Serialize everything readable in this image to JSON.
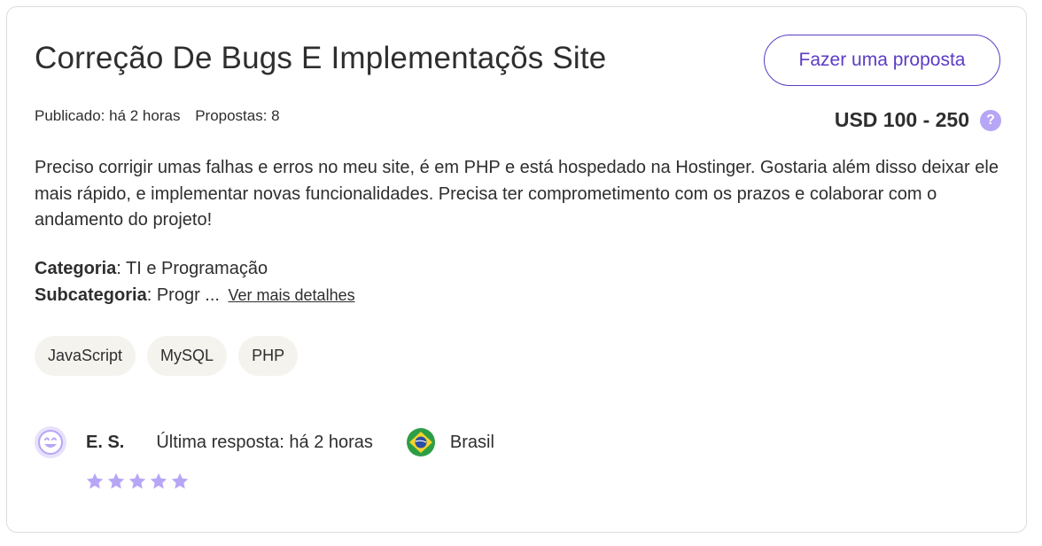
{
  "project": {
    "title": "Correção De Bugs E Implementaçõs Site",
    "proposal_button": "Fazer uma proposta",
    "published": "Publicado: há 2 horas",
    "proposals": "Propostas: 8",
    "budget": "USD 100 - 250",
    "budget_help_icon": "?",
    "description": "Preciso corrigir umas falhas e erros no meu site, é em PHP e está hospedado na Hostinger. Gostaria além disso deixar ele mais rápido, e implementar novas funcionalidades. Precisa ter comprometimento com os prazos e colaborar com o andamento do projeto!",
    "category_label": "Categoria",
    "category_value": ": TI e Programação",
    "subcategory_label": "Subcategoria",
    "subcategory_value": ": Progr ...",
    "more_details_link": "Ver mais detalhes",
    "tags": [
      "JavaScript",
      "MySQL",
      "PHP"
    ]
  },
  "client": {
    "avatar_icon": "smiley-face-icon",
    "name": "E. S.",
    "last_reply": "Última resposta: há 2 horas",
    "country_flag_icon": "brazil-flag-icon",
    "country": "Brasil",
    "rating_stars": 5
  },
  "colors": {
    "accent": "#5b3cc4",
    "accent_light": "#b7a6f5",
    "tag_background": "#f5f3ee",
    "border": "#dcdcdc"
  }
}
